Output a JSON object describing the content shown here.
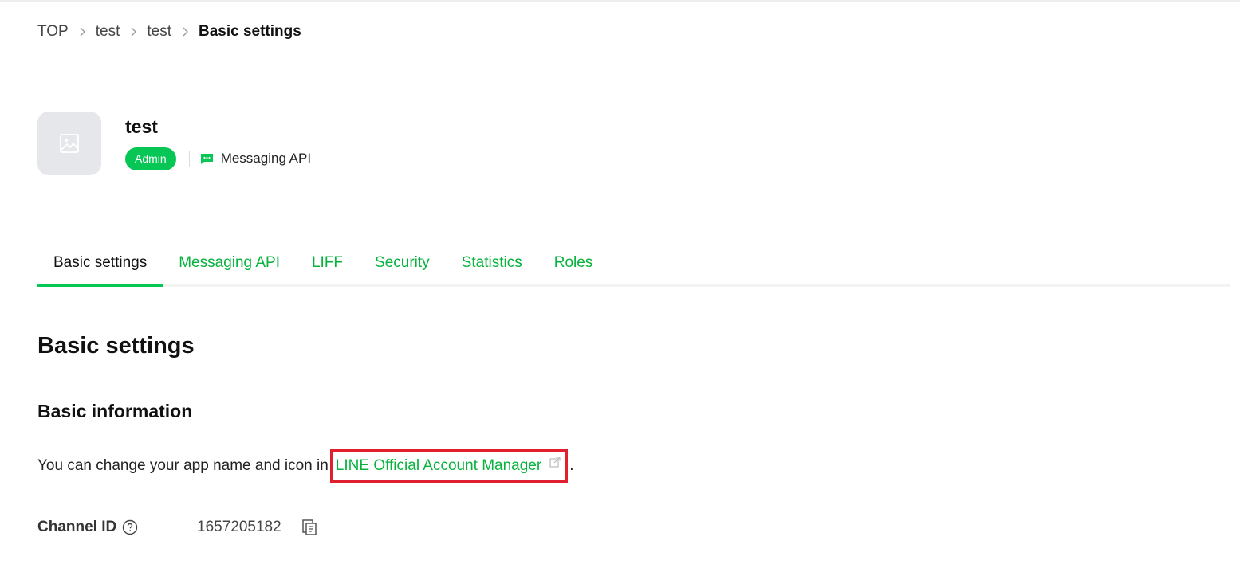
{
  "breadcrumb": {
    "items": [
      {
        "label": "TOP"
      },
      {
        "label": "test"
      },
      {
        "label": "test"
      },
      {
        "label": "Basic settings"
      }
    ]
  },
  "channel": {
    "name": "test",
    "role_badge": "Admin",
    "type_label": "Messaging API"
  },
  "tabs": [
    {
      "label": "Basic settings",
      "active": true
    },
    {
      "label": "Messaging API",
      "active": false
    },
    {
      "label": "LIFF",
      "active": false
    },
    {
      "label": "Security",
      "active": false
    },
    {
      "label": "Statistics",
      "active": false
    },
    {
      "label": "Roles",
      "active": false
    }
  ],
  "main": {
    "page_title": "Basic settings",
    "section_title": "Basic information",
    "info_text": "You can change your app name and icon in",
    "info_link": "LINE Official Account Manager",
    "info_suffix": ".",
    "channel_id_label": "Channel ID",
    "channel_id_value": "1657205182"
  },
  "icons": {
    "breadcrumb_separator": "chevron-right-icon",
    "channel_placeholder": "image-icon",
    "channel_type": "chat-bubble-icon",
    "external_link": "external-link-icon",
    "help": "question-circle-icon",
    "copy": "copy-icon"
  },
  "colors": {
    "accent_green": "#06c755",
    "link_green": "#06b33d",
    "highlight_red": "#e0202e"
  }
}
